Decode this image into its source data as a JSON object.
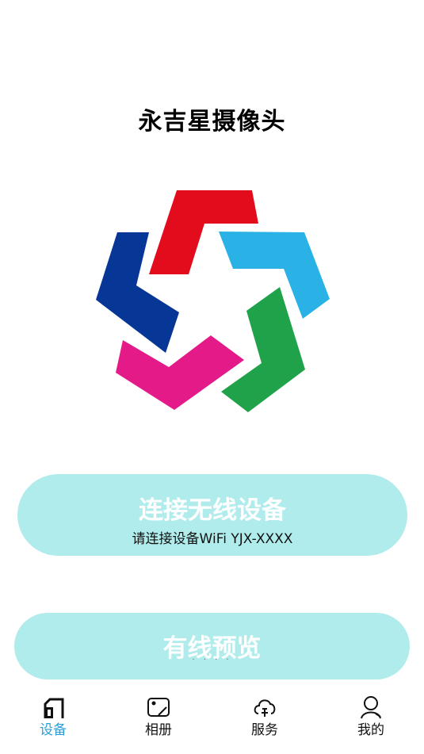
{
  "app": {
    "title": "永吉星摄像头"
  },
  "logo": {
    "name": "yongjixing-star-logo",
    "colors": [
      "#e30c1c",
      "#2ab2e6",
      "#1fa24a",
      "#e51a89",
      "#063696"
    ]
  },
  "buttons": {
    "wireless": {
      "title": "连接无线设备",
      "subtitle": "请连接设备WiFi YJX-XXXX"
    },
    "wired": {
      "title": "有线预览"
    }
  },
  "tabs": [
    {
      "label": "设备",
      "icon": "device-icon",
      "active": true
    },
    {
      "label": "相册",
      "icon": "album-icon",
      "active": false
    },
    {
      "label": "服务",
      "icon": "service-icon",
      "active": false
    },
    {
      "label": "我的",
      "icon": "profile-icon",
      "active": false
    }
  ],
  "colors": {
    "button_bg": "#b0ecec",
    "tab_active": "#2a9fd6"
  }
}
